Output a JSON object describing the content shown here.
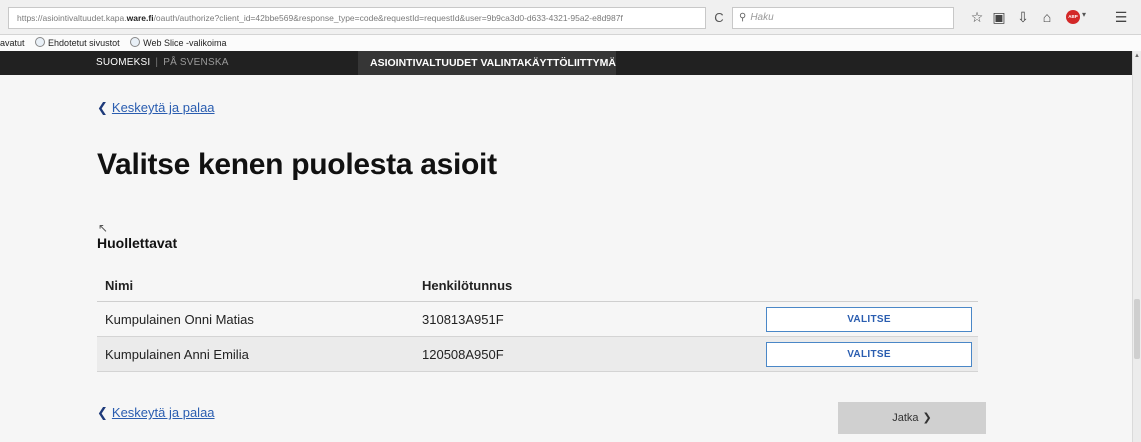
{
  "browser": {
    "url_prefix": "https://asiointivaltuudet.kapa.",
    "url_host": "ware.fi",
    "url_suffix": "/oauth/authorize?client_id=42bbe569&response_type=code&requestId=requestId&user=9b9ca3d0-d633-4321-95a2-e8d987f",
    "reload_icon": "C",
    "search_placeholder": "Haku"
  },
  "bookmarks": [
    {
      "label": "avatut"
    },
    {
      "label": "Ehdotetut sivustot"
    },
    {
      "label": "Web Slice -valikoima"
    }
  ],
  "header": {
    "lang_fi": "SUOMEKSI",
    "lang_sep": "|",
    "lang_sv": "PÅ SVENSKA",
    "app_title": "ASIOINTIVALTUUDET VALINTAKÄYTTÖLIITTYMÄ"
  },
  "main": {
    "cancel_link": "Keskeytä ja palaa",
    "title": "Valitse kenen puolesta asioit",
    "section_title": "Huollettavat",
    "columns": [
      "Nimi",
      "Henkilötunnus"
    ],
    "rows": [
      {
        "name": "Kumpulainen Onni Matias",
        "id": "310813A951F",
        "button": "VALITSE"
      },
      {
        "name": "Kumpulainen Anni Emilia",
        "id": "120508A950F",
        "button": "VALITSE"
      }
    ],
    "continue_button": "Jatka"
  }
}
